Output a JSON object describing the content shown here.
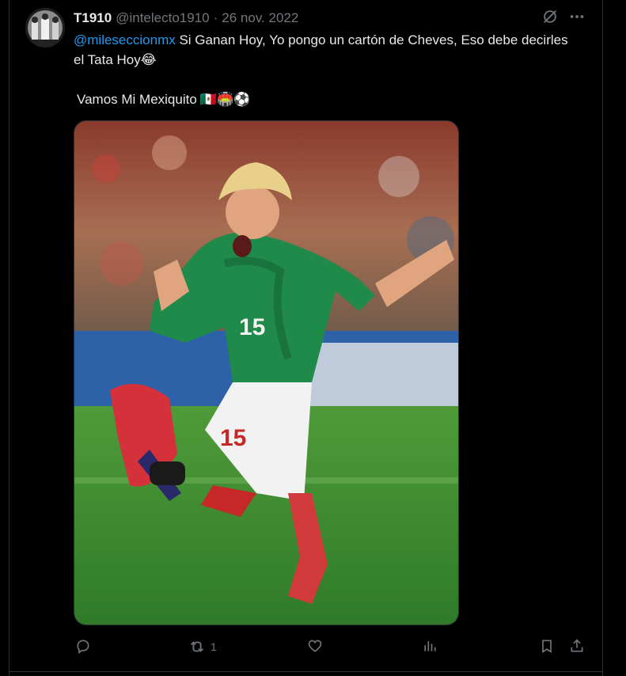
{
  "tweet": {
    "author_name": "T1910",
    "author_handle": "@intelecto1910",
    "separator": "·",
    "date": "26 nov. 2022",
    "mention": "@mileseccionmx",
    "text_part1": " Si Ganan Hoy, Yo pongo un cartón de Cheves, Eso debe decirles el Tata Hoy",
    "emoji1": "😂",
    "line2_text": "Vamos Mi Mexiquito",
    "line2_emojis": "🇲🇽🏟️⚽",
    "media_description": "",
    "retweet_count": "1"
  },
  "colors": {
    "background": "#000000",
    "text": "#e7e9ea",
    "secondary": "#71767b",
    "link": "#1d9bf0",
    "border": "#2f3336"
  },
  "icons": {
    "grok": "grok-icon",
    "more": "more-icon",
    "reply": "reply-icon",
    "retweet": "retweet-icon",
    "like": "like-icon",
    "views": "views-icon",
    "bookmark": "bookmark-icon",
    "share": "share-icon"
  }
}
